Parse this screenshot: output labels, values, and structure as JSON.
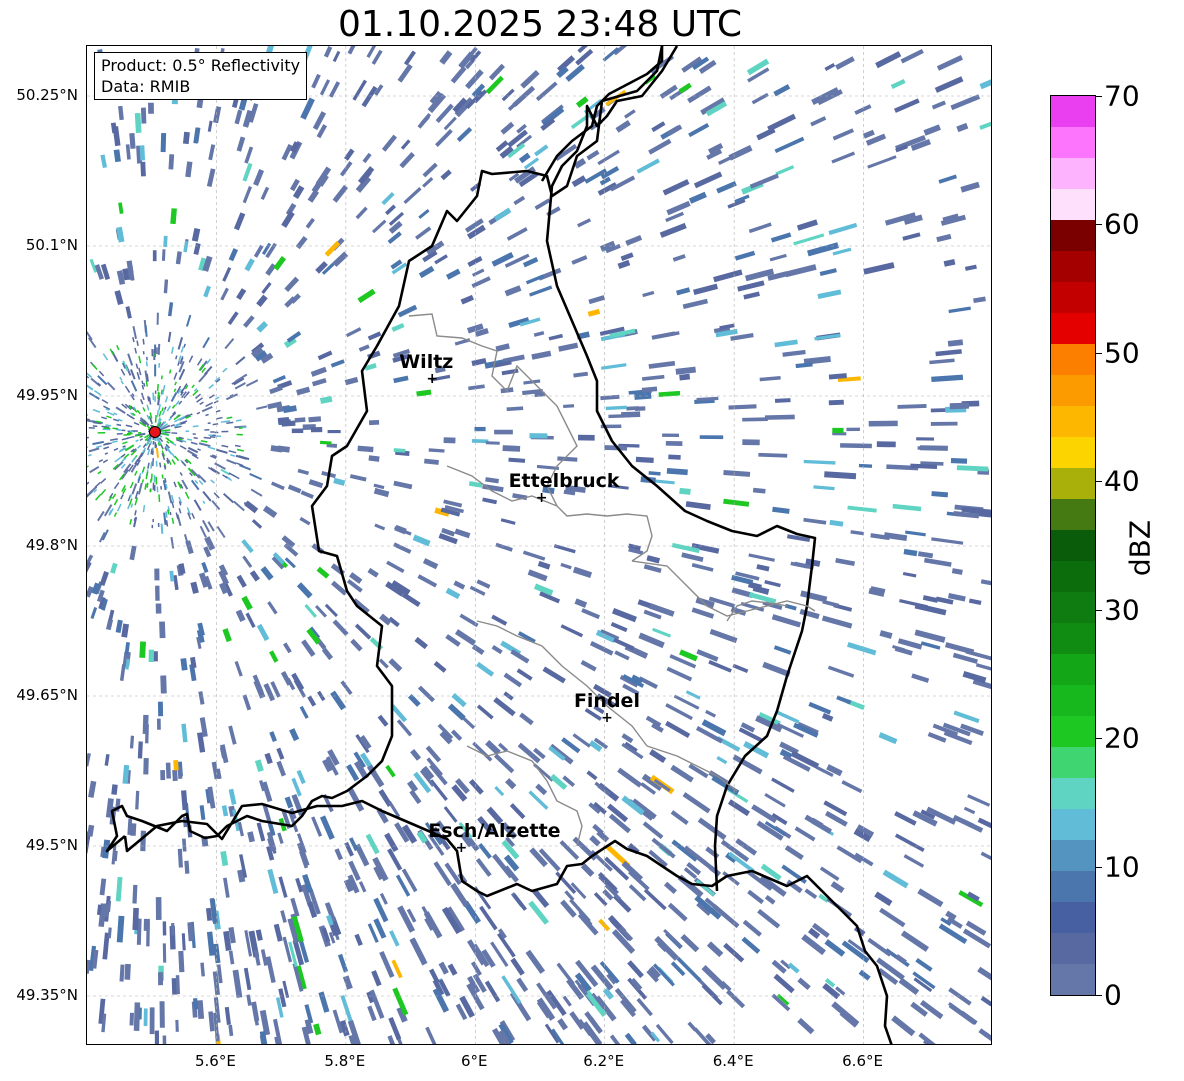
{
  "title": "01.10.2025 23:48 UTC",
  "info": {
    "product": "Product: 0.5° Reflectivity",
    "source": "Data: RMIB"
  },
  "axes": {
    "y_ticks": [
      {
        "label": "50.25°N",
        "lat": 50.25
      },
      {
        "label": "50.1°N",
        "lat": 50.1
      },
      {
        "label": "49.95°N",
        "lat": 49.95
      },
      {
        "label": "49.8°N",
        "lat": 49.8
      },
      {
        "label": "49.65°N",
        "lat": 49.65
      },
      {
        "label": "49.5°N",
        "lat": 49.5
      },
      {
        "label": "49.35°N",
        "lat": 49.35
      }
    ],
    "x_ticks": [
      {
        "label": "5.6°E",
        "lon": 5.6
      },
      {
        "label": "5.8°E",
        "lon": 5.8
      },
      {
        "label": "6°E",
        "lon": 6.0
      },
      {
        "label": "6.2°E",
        "lon": 6.2
      },
      {
        "label": "6.4°E",
        "lon": 6.4
      },
      {
        "label": "6.6°E",
        "lon": 6.6
      }
    ],
    "lon_range": [
      5.4,
      6.8
    ],
    "lat_range": [
      49.3,
      50.3
    ]
  },
  "cities": [
    {
      "name": "Wiltz",
      "lon": 5.935,
      "lat": 49.966
    },
    {
      "name": "Ettelbruck",
      "lon": 6.104,
      "lat": 49.847
    },
    {
      "name": "Findel",
      "lon": 6.205,
      "lat": 49.627
    },
    {
      "name": "Esch/Alzette",
      "lon": 5.98,
      "lat": 49.497
    }
  ],
  "radar_site": {
    "name": "radar",
    "lon": 5.505,
    "lat": 49.914,
    "color": "#e8141c"
  },
  "colorbar": {
    "label": "dBZ",
    "min": 0,
    "max": 70,
    "ticks": [
      0,
      10,
      20,
      30,
      40,
      50,
      60,
      70
    ],
    "tick_labels": [
      "0",
      "10",
      "20",
      "30",
      "40",
      "50",
      "60",
      "70"
    ],
    "colors": [
      "#6577a8",
      "#5868a0",
      "#4660a2",
      "#4a75ad",
      "#5395c0",
      "#61bcd8",
      "#5fd4c2",
      "#3fd570",
      "#1dc823",
      "#17b81d",
      "#13a616",
      "#108c13",
      "#0e7c10",
      "#0c6d0c",
      "#0a5c0b",
      "#457a12",
      "#a9b00a",
      "#fcd500",
      "#fdb700",
      "#fc9b00",
      "#fd7f00",
      "#e50000",
      "#c30000",
      "#a50000",
      "#7a0000",
      "#fee0fd",
      "#fdb3fd",
      "#fc75fc",
      "#e93ff0"
    ]
  },
  "colors": {
    "border_national": "#000000",
    "border_regional": "#8a8a8a",
    "grid": "#b0b0b0",
    "echo_main": "#5c70a6"
  }
}
